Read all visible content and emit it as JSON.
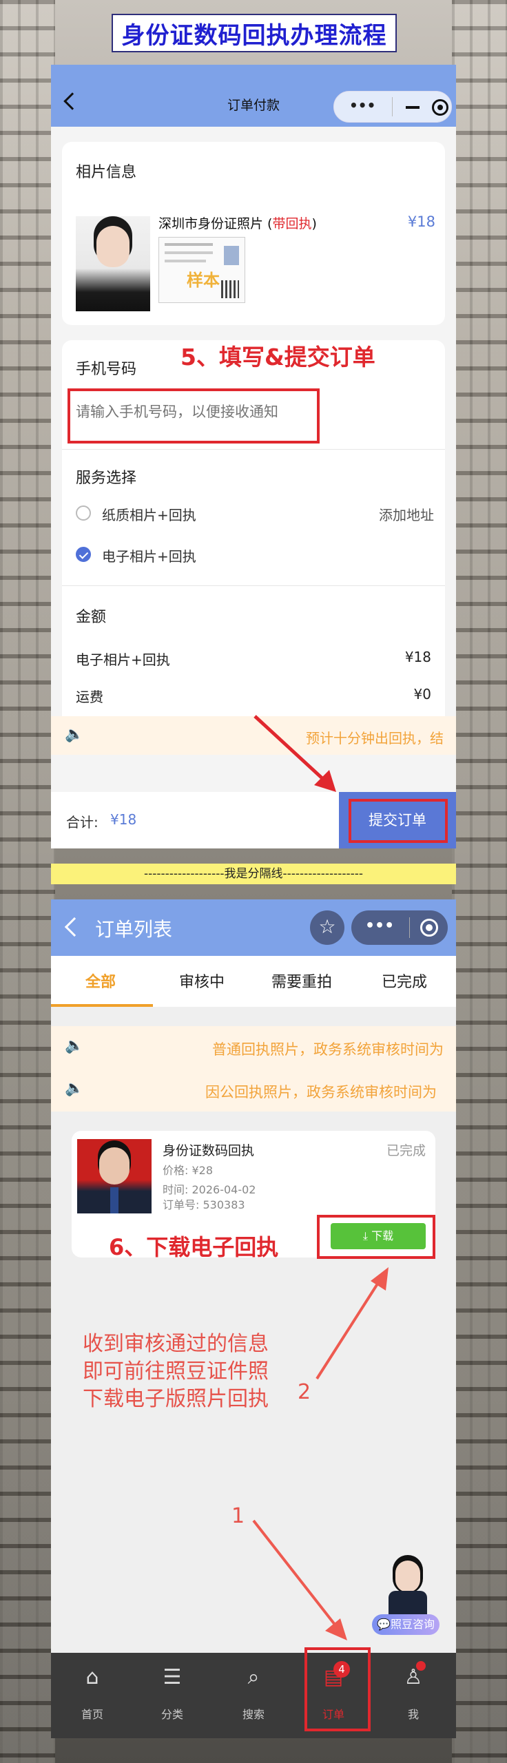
{
  "page_title": "身份证数码回执办理流程",
  "screen1": {
    "nav_title": "订单付款",
    "photo_section_title": "相片信息",
    "product_name": "深圳市身份证照片",
    "product_tag_open": " (",
    "product_tag": "带回执",
    "product_tag_close": ")",
    "product_price": "¥18",
    "sample_watermark": "样本",
    "phone_label": "手机号码",
    "phone_placeholder": "请输入手机号码，以便接收通知",
    "service_label": "服务选择",
    "options": [
      {
        "label": "纸质相片+回执",
        "selected": false
      },
      {
        "label": "电子相片+回执",
        "selected": true
      }
    ],
    "add_address": "添加地址",
    "amount_label": "金额",
    "amount_rows": [
      {
        "label": "电子相片+回执",
        "value": "¥18"
      },
      {
        "label": "运费",
        "value": "¥0"
      }
    ],
    "notice": "预计十分钟出回执，结",
    "total_label": "合计:",
    "total_value": "¥18",
    "submit_button": "提交订单"
  },
  "step5_annotation": "5、填写&提交订单",
  "divider_text": "-------------------我是分隔线-------------------",
  "screen2": {
    "nav_title": "订单列表",
    "tabs": [
      "全部",
      "审核中",
      "需要重拍",
      "已完成"
    ],
    "active_tab": 0,
    "notices": [
      "普通回执照片，政务系统审核时间为",
      "因公回执照片，政务系统审核时间为"
    ],
    "order": {
      "title": "身份证数码回执",
      "status": "已完成",
      "price": "价格: ¥28",
      "time": "时间: 2026-04-02",
      "order_no": "订单号: 530383",
      "download_button": "下载"
    },
    "consult_label": "照豆咨询",
    "tabbar": [
      {
        "label": "首页",
        "icon": "home-icon"
      },
      {
        "label": "分类",
        "icon": "category-icon"
      },
      {
        "label": "搜索",
        "icon": "search-icon"
      },
      {
        "label": "订单",
        "icon": "order-icon",
        "badge": "4"
      },
      {
        "label": "我",
        "icon": "user-icon"
      }
    ]
  },
  "step6_annotation": "6、下载电子回执",
  "note_annotation": [
    "收到审核通过的信息",
    "即可前往照豆证件照",
    "下载电子版照片回执"
  ],
  "arrow_label_1": "1",
  "arrow_label_2": "2",
  "colors": {
    "nav": "#7ea2e8",
    "accent_blue": "#5a7bd6",
    "annotation_red": "#e0282e",
    "download_green": "#57c23a",
    "tab_active": "#f0a02a"
  }
}
